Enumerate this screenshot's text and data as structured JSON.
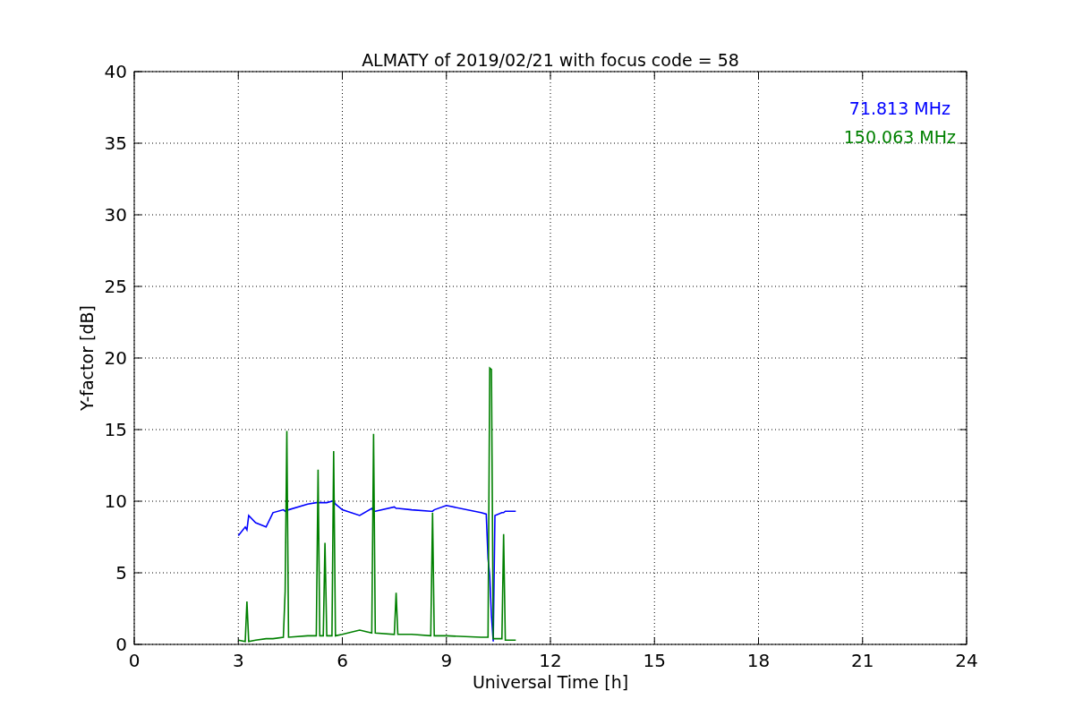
{
  "chart": {
    "chart_data": {
      "type": "line",
      "title": "ALMATY of 2019/02/21 with focus code = 58",
      "xlabel": "Universal Time [h]",
      "ylabel": "Y-factor [dB]",
      "x": [
        3.0,
        3.2,
        3.25,
        3.3,
        3.5,
        3.8,
        4.0,
        4.3,
        4.35,
        4.4,
        4.45,
        5.0,
        5.25,
        5.3,
        5.35,
        5.45,
        5.5,
        5.55,
        5.7,
        5.75,
        5.8,
        6.0,
        6.5,
        6.85,
        6.9,
        6.95,
        7.5,
        7.55,
        7.6,
        8.0,
        8.55,
        8.6,
        8.65,
        9.0,
        10.0,
        10.15,
        10.2,
        10.25,
        10.3,
        10.35,
        10.4,
        10.6,
        10.65,
        10.7,
        11.0
      ],
      "series": [
        {
          "name": "71.813 MHz",
          "color": "#0000ff",
          "values": [
            7.6,
            8.2,
            8.0,
            9.0,
            8.5,
            8.2,
            9.2,
            9.4,
            9.3,
            9.4,
            9.4,
            9.8,
            9.9,
            9.9,
            9.9,
            9.9,
            9.9,
            9.9,
            10.0,
            10.0,
            9.8,
            9.4,
            9.0,
            9.5,
            9.3,
            9.3,
            9.6,
            9.5,
            9.5,
            9.4,
            9.3,
            9.3,
            9.4,
            9.7,
            9.2,
            9.1,
            6.0,
            4.8,
            2.0,
            0.2,
            9.0,
            9.2,
            9.2,
            9.3,
            9.3
          ]
        },
        {
          "name": "150.063 MHz",
          "color": "#008000",
          "values": [
            0.3,
            0.2,
            3.0,
            0.2,
            0.3,
            0.4,
            0.4,
            0.5,
            3.7,
            14.9,
            0.5,
            0.6,
            0.6,
            12.2,
            0.6,
            0.6,
            7.1,
            0.6,
            0.6,
            13.5,
            0.6,
            0.7,
            1.0,
            0.8,
            14.7,
            0.8,
            0.7,
            3.6,
            0.7,
            0.7,
            0.6,
            9.2,
            0.6,
            0.6,
            0.5,
            0.5,
            0.5,
            19.3,
            19.2,
            0.4,
            0.4,
            0.4,
            7.7,
            0.3,
            0.3
          ]
        }
      ],
      "xlim": [
        0,
        24
      ],
      "ylim": [
        0,
        40
      ],
      "xticks": [
        0,
        3,
        6,
        9,
        12,
        15,
        18,
        21,
        24
      ],
      "yticks": [
        0,
        5,
        10,
        15,
        20,
        25,
        30,
        35,
        40
      ],
      "grid": true
    }
  }
}
